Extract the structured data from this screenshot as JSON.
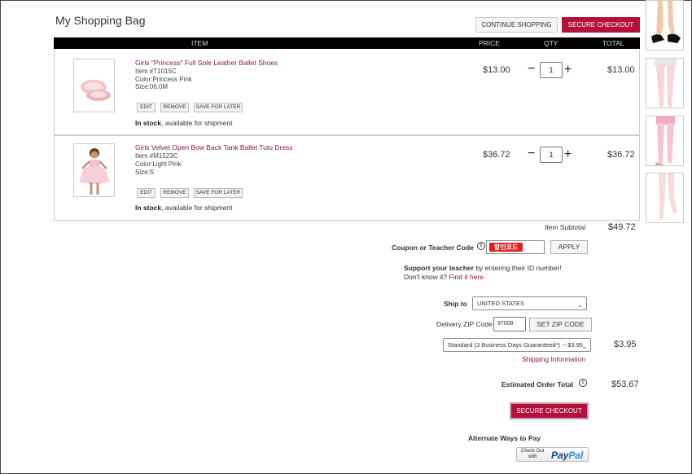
{
  "page": {
    "title": "My Shopping Bag"
  },
  "toolbar": {
    "continue_label": "CONTINUE SHOPPING",
    "secure_checkout_label": "SECURE CHECKOUT"
  },
  "table_headers": {
    "item": "ITEM",
    "price": "PRICE",
    "qty": "QTY",
    "total": "TOTAL"
  },
  "items": [
    {
      "name": "Girls \"Princess\" Full Sole Leather Ballet Shoes",
      "item_no": "Item #T1015C",
      "color": "Color:Princess Pink",
      "size": "Size:06.0M",
      "edit": "EDIT",
      "remove": "REMOVE",
      "save": "SAVE FOR LATER",
      "stock_bold": "In stock",
      "stock_rest": ", available for shipment",
      "price": "$13.00",
      "qty": "1",
      "total": "$13.00"
    },
    {
      "name": "Girls Velvet Open Bow Back Tank Ballet Tutu Dress",
      "item_no": "Item #M1523C",
      "color": "Color:Light Pink",
      "size": "Size:S",
      "edit": "EDIT",
      "remove": "REMOVE",
      "save": "SAVE FOR LATER",
      "stock_bold": "In stock",
      "stock_rest": ", available for shipment",
      "price": "$36.72",
      "qty": "1",
      "total": "$36.72"
    }
  ],
  "summary": {
    "subtotal_label": "Item Subtotal",
    "subtotal_value": "$49.72",
    "coupon_label": "Coupon or Teacher Code",
    "coupon_badge": "할인코드",
    "apply_label": "APPLY",
    "support_bold": "Support your teacher",
    "support_rest": " by entering their ID number!",
    "dont_know": "Don't know it? ",
    "find_link": "Find it here",
    "ship_to_label": "Ship to",
    "country": "UNITED STATES",
    "zip_label": "Delivery ZIP Code",
    "zip_value": "97008",
    "set_zip_label": "SET ZIP CODE",
    "shipping_option": "Standard (3 Business Days Guaranteed*) -- $3.95",
    "shipping_value": "$3.95",
    "shipping_info_link": "Shipping Information",
    "estimated_label": "Estimated Order Total",
    "estimated_value": "$53.67",
    "secure_checkout_label": "SECURE CHECKOUT",
    "alt_pay_label": "Alternate Ways to Pay",
    "paypal_checkout": "Check Out",
    "paypal_with": "with",
    "paypal_brand_a": "Pay",
    "paypal_brand_b": "Pal"
  },
  "colors": {
    "accent": "#b5103c",
    "link": "#8b1c2f",
    "header_bg": "#000000"
  },
  "icons": {
    "qty_minus": "minus-icon",
    "qty_plus": "plus-icon",
    "info": "info-icon",
    "dropdown": "chevron-down-icon"
  }
}
